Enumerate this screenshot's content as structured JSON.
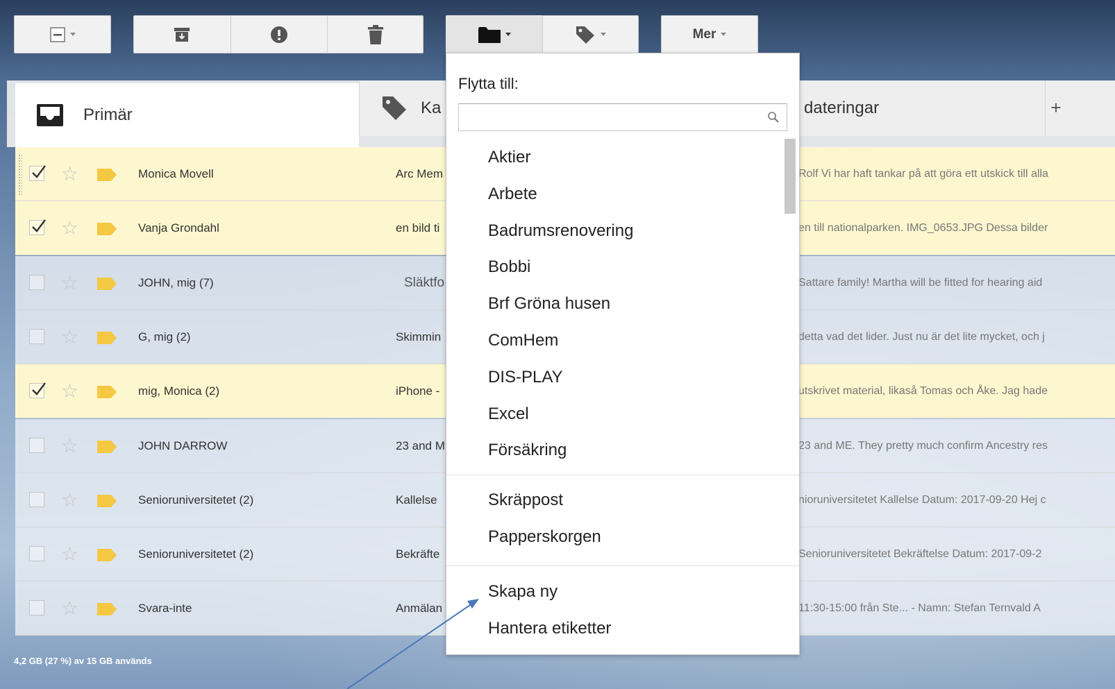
{
  "toolbar": {
    "more_label": "Mer"
  },
  "tabs": {
    "primary": "Primär",
    "social_partial": "Ka",
    "updates_partial": "dateringar",
    "add": "+"
  },
  "emails": [
    {
      "sender": "Monica Movell",
      "subject": "Arc Mem",
      "snippet": "Rolf Vi har haft tankar på att göra ett utskick till alla",
      "checked": true
    },
    {
      "sender": "Vanja Grondahl",
      "subject": "en bild ti",
      "snippet": "en till nationalparken. IMG_0653.JPG Dessa bilder",
      "checked": true
    },
    {
      "sender": "JOHN, mig (7)",
      "subject": "Släktfo",
      "snippet": "Sattare family! Martha will be fitted for hearing aid",
      "checked": false
    },
    {
      "sender": "G, mig (2)",
      "subject": "Skimmin",
      "snippet": "detta vad det lider. Just nu är det lite mycket, och j",
      "checked": false
    },
    {
      "sender": "mig, Monica (2)",
      "subject": "iPhone -",
      "snippet": "utskrivet material, likaså Tomas och Åke. Jag hade",
      "checked": true
    },
    {
      "sender": "JOHN DARROW",
      "subject": "23 and M",
      "snippet": "23 and ME. They pretty much confirm Ancestry res",
      "checked": false
    },
    {
      "sender": "Senioruniversitetet (2)",
      "subject": "Kallelse",
      "snippet": "nioruniversitetet Kallelse Datum: 2017-09-20 Hej c",
      "checked": false
    },
    {
      "sender": "Senioruniversitetet (2)",
      "subject": "Bekräfte",
      "snippet": "Senioruniversitetet Bekräftelse Datum: 2017-09-2",
      "checked": false
    },
    {
      "sender": "Svara-inte",
      "subject": "Anmälan",
      "snippet": "11:30-15:00 från Ste... - Namn: Stefan Ternvald A",
      "checked": false
    }
  ],
  "footer": {
    "storage": "4,2 GB (27 %) av 15 GB används"
  },
  "move_menu": {
    "title": "Flytta till:",
    "search_value": "",
    "labels": [
      "Aktier",
      "Arbete",
      "Badrumsrenovering",
      "Bobbi",
      "Brf Gröna husen",
      "ComHem",
      "DIS-PLAY",
      "Excel",
      "Försäkring"
    ],
    "system": [
      "Skräppost",
      "Papperskorgen"
    ],
    "actions": [
      "Skapa ny",
      "Hantera etiketter"
    ]
  },
  "colors": {
    "selected_row": "#fdf7cf",
    "importance_marker": "#f5c842",
    "annotation_arrow": "#4a78b8"
  }
}
